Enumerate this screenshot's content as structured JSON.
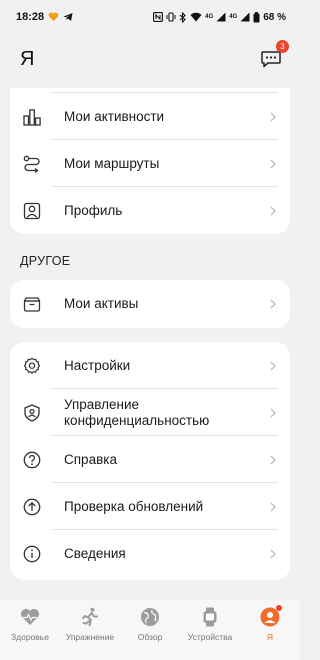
{
  "status_bar": {
    "time": "18:28",
    "network_1": "4G",
    "network_2": "4G",
    "battery": "68 %"
  },
  "header": {
    "title": "Я",
    "messages_badge": "3"
  },
  "card_top": [
    {
      "label": "Мои активности",
      "icon": "activity-icon"
    },
    {
      "label": "Мои маршруты",
      "icon": "route-icon"
    },
    {
      "label": "Профиль",
      "icon": "profile-icon"
    }
  ],
  "section_other": "ДРУГОЕ",
  "card_assets": [
    {
      "label": "Мои активы",
      "icon": "wallet-icon"
    }
  ],
  "card_settings": [
    {
      "label": "Настройки",
      "icon": "gear-icon"
    },
    {
      "label": "Управление конфиденциальностью",
      "icon": "privacy-icon"
    },
    {
      "label": "Справка",
      "icon": "help-icon"
    },
    {
      "label": "Проверка обновлений",
      "icon": "update-icon"
    },
    {
      "label": "Сведения",
      "icon": "info-icon"
    }
  ],
  "bottom_nav": [
    {
      "label": "Здоровье",
      "icon": "heart-icon"
    },
    {
      "label": "Упражнение",
      "icon": "running-icon"
    },
    {
      "label": "Обзор",
      "icon": "globe-icon"
    },
    {
      "label": "Устройства",
      "icon": "watch-icon"
    },
    {
      "label": "Я",
      "icon": "me-icon",
      "active": true
    }
  ],
  "colors": {
    "accent": "#f26b2a",
    "badge": "#e8452c",
    "background": "#f1f1f3"
  }
}
